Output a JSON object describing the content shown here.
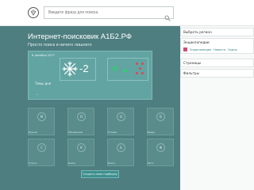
{
  "header": {
    "search_placeholder": "Введите фразу для поиска"
  },
  "hero": {
    "title": "Интернет-поисковик А1Б2.РФ",
    "subtitle": "Просто поиск и ничего лишнего"
  },
  "widget": {
    "date": "8 декабря 2017",
    "temperature": "-2",
    "label": "Темы дня",
    "value": "..."
  },
  "tiles": [
    {
      "letter": "М",
      "label": "Музыка"
    },
    {
      "letter": "О",
      "label": "Объявления"
    },
    {
      "letter": "О",
      "label": "Отзывы"
    },
    {
      "letter": "В",
      "label": "Видео"
    },
    {
      "letter": "С",
      "label": "Статьи"
    },
    {
      "letter": "К",
      "label": "Книги"
    },
    {
      "letter": "Б",
      "label": "Блоги"
    },
    {
      "letter": "Ф",
      "label": "Фото"
    }
  ],
  "add_button": "Создать свою подборку",
  "sidebar": {
    "region": "Выбрать регион",
    "encyclopedias": "Энциклопедии",
    "links": [
      "Энциклопедия",
      "Новости",
      "Курсы"
    ],
    "pages": "Страницы",
    "filters": "Фильтры"
  },
  "colors": {
    "hero": "#4e7e7f",
    "widget": "#62a4a2",
    "accent_pink": "#d24b79",
    "ruble_green": "#2ed06b",
    "dot_red": "#e0454f"
  }
}
